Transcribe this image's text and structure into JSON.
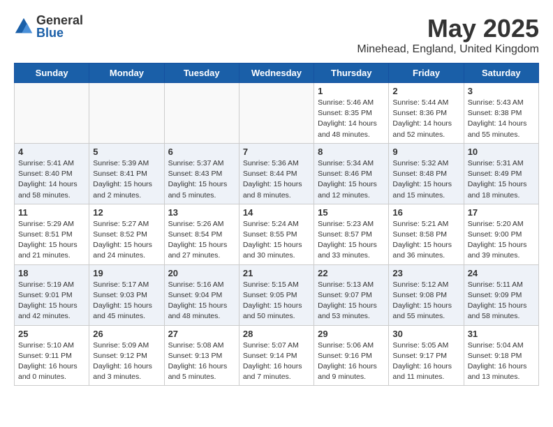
{
  "logo": {
    "general": "General",
    "blue": "Blue"
  },
  "title": "May 2025",
  "subtitle": "Minehead, England, United Kingdom",
  "weekdays": [
    "Sunday",
    "Monday",
    "Tuesday",
    "Wednesday",
    "Thursday",
    "Friday",
    "Saturday"
  ],
  "weeks": [
    [
      {
        "day": "",
        "info": ""
      },
      {
        "day": "",
        "info": ""
      },
      {
        "day": "",
        "info": ""
      },
      {
        "day": "",
        "info": ""
      },
      {
        "day": "1",
        "info": "Sunrise: 5:46 AM\nSunset: 8:35 PM\nDaylight: 14 hours\nand 48 minutes."
      },
      {
        "day": "2",
        "info": "Sunrise: 5:44 AM\nSunset: 8:36 PM\nDaylight: 14 hours\nand 52 minutes."
      },
      {
        "day": "3",
        "info": "Sunrise: 5:43 AM\nSunset: 8:38 PM\nDaylight: 14 hours\nand 55 minutes."
      }
    ],
    [
      {
        "day": "4",
        "info": "Sunrise: 5:41 AM\nSunset: 8:40 PM\nDaylight: 14 hours\nand 58 minutes."
      },
      {
        "day": "5",
        "info": "Sunrise: 5:39 AM\nSunset: 8:41 PM\nDaylight: 15 hours\nand 2 minutes."
      },
      {
        "day": "6",
        "info": "Sunrise: 5:37 AM\nSunset: 8:43 PM\nDaylight: 15 hours\nand 5 minutes."
      },
      {
        "day": "7",
        "info": "Sunrise: 5:36 AM\nSunset: 8:44 PM\nDaylight: 15 hours\nand 8 minutes."
      },
      {
        "day": "8",
        "info": "Sunrise: 5:34 AM\nSunset: 8:46 PM\nDaylight: 15 hours\nand 12 minutes."
      },
      {
        "day": "9",
        "info": "Sunrise: 5:32 AM\nSunset: 8:48 PM\nDaylight: 15 hours\nand 15 minutes."
      },
      {
        "day": "10",
        "info": "Sunrise: 5:31 AM\nSunset: 8:49 PM\nDaylight: 15 hours\nand 18 minutes."
      }
    ],
    [
      {
        "day": "11",
        "info": "Sunrise: 5:29 AM\nSunset: 8:51 PM\nDaylight: 15 hours\nand 21 minutes."
      },
      {
        "day": "12",
        "info": "Sunrise: 5:27 AM\nSunset: 8:52 PM\nDaylight: 15 hours\nand 24 minutes."
      },
      {
        "day": "13",
        "info": "Sunrise: 5:26 AM\nSunset: 8:54 PM\nDaylight: 15 hours\nand 27 minutes."
      },
      {
        "day": "14",
        "info": "Sunrise: 5:24 AM\nSunset: 8:55 PM\nDaylight: 15 hours\nand 30 minutes."
      },
      {
        "day": "15",
        "info": "Sunrise: 5:23 AM\nSunset: 8:57 PM\nDaylight: 15 hours\nand 33 minutes."
      },
      {
        "day": "16",
        "info": "Sunrise: 5:21 AM\nSunset: 8:58 PM\nDaylight: 15 hours\nand 36 minutes."
      },
      {
        "day": "17",
        "info": "Sunrise: 5:20 AM\nSunset: 9:00 PM\nDaylight: 15 hours\nand 39 minutes."
      }
    ],
    [
      {
        "day": "18",
        "info": "Sunrise: 5:19 AM\nSunset: 9:01 PM\nDaylight: 15 hours\nand 42 minutes."
      },
      {
        "day": "19",
        "info": "Sunrise: 5:17 AM\nSunset: 9:03 PM\nDaylight: 15 hours\nand 45 minutes."
      },
      {
        "day": "20",
        "info": "Sunrise: 5:16 AM\nSunset: 9:04 PM\nDaylight: 15 hours\nand 48 minutes."
      },
      {
        "day": "21",
        "info": "Sunrise: 5:15 AM\nSunset: 9:05 PM\nDaylight: 15 hours\nand 50 minutes."
      },
      {
        "day": "22",
        "info": "Sunrise: 5:13 AM\nSunset: 9:07 PM\nDaylight: 15 hours\nand 53 minutes."
      },
      {
        "day": "23",
        "info": "Sunrise: 5:12 AM\nSunset: 9:08 PM\nDaylight: 15 hours\nand 55 minutes."
      },
      {
        "day": "24",
        "info": "Sunrise: 5:11 AM\nSunset: 9:09 PM\nDaylight: 15 hours\nand 58 minutes."
      }
    ],
    [
      {
        "day": "25",
        "info": "Sunrise: 5:10 AM\nSunset: 9:11 PM\nDaylight: 16 hours\nand 0 minutes."
      },
      {
        "day": "26",
        "info": "Sunrise: 5:09 AM\nSunset: 9:12 PM\nDaylight: 16 hours\nand 3 minutes."
      },
      {
        "day": "27",
        "info": "Sunrise: 5:08 AM\nSunset: 9:13 PM\nDaylight: 16 hours\nand 5 minutes."
      },
      {
        "day": "28",
        "info": "Sunrise: 5:07 AM\nSunset: 9:14 PM\nDaylight: 16 hours\nand 7 minutes."
      },
      {
        "day": "29",
        "info": "Sunrise: 5:06 AM\nSunset: 9:16 PM\nDaylight: 16 hours\nand 9 minutes."
      },
      {
        "day": "30",
        "info": "Sunrise: 5:05 AM\nSunset: 9:17 PM\nDaylight: 16 hours\nand 11 minutes."
      },
      {
        "day": "31",
        "info": "Sunrise: 5:04 AM\nSunset: 9:18 PM\nDaylight: 16 hours\nand 13 minutes."
      }
    ]
  ]
}
